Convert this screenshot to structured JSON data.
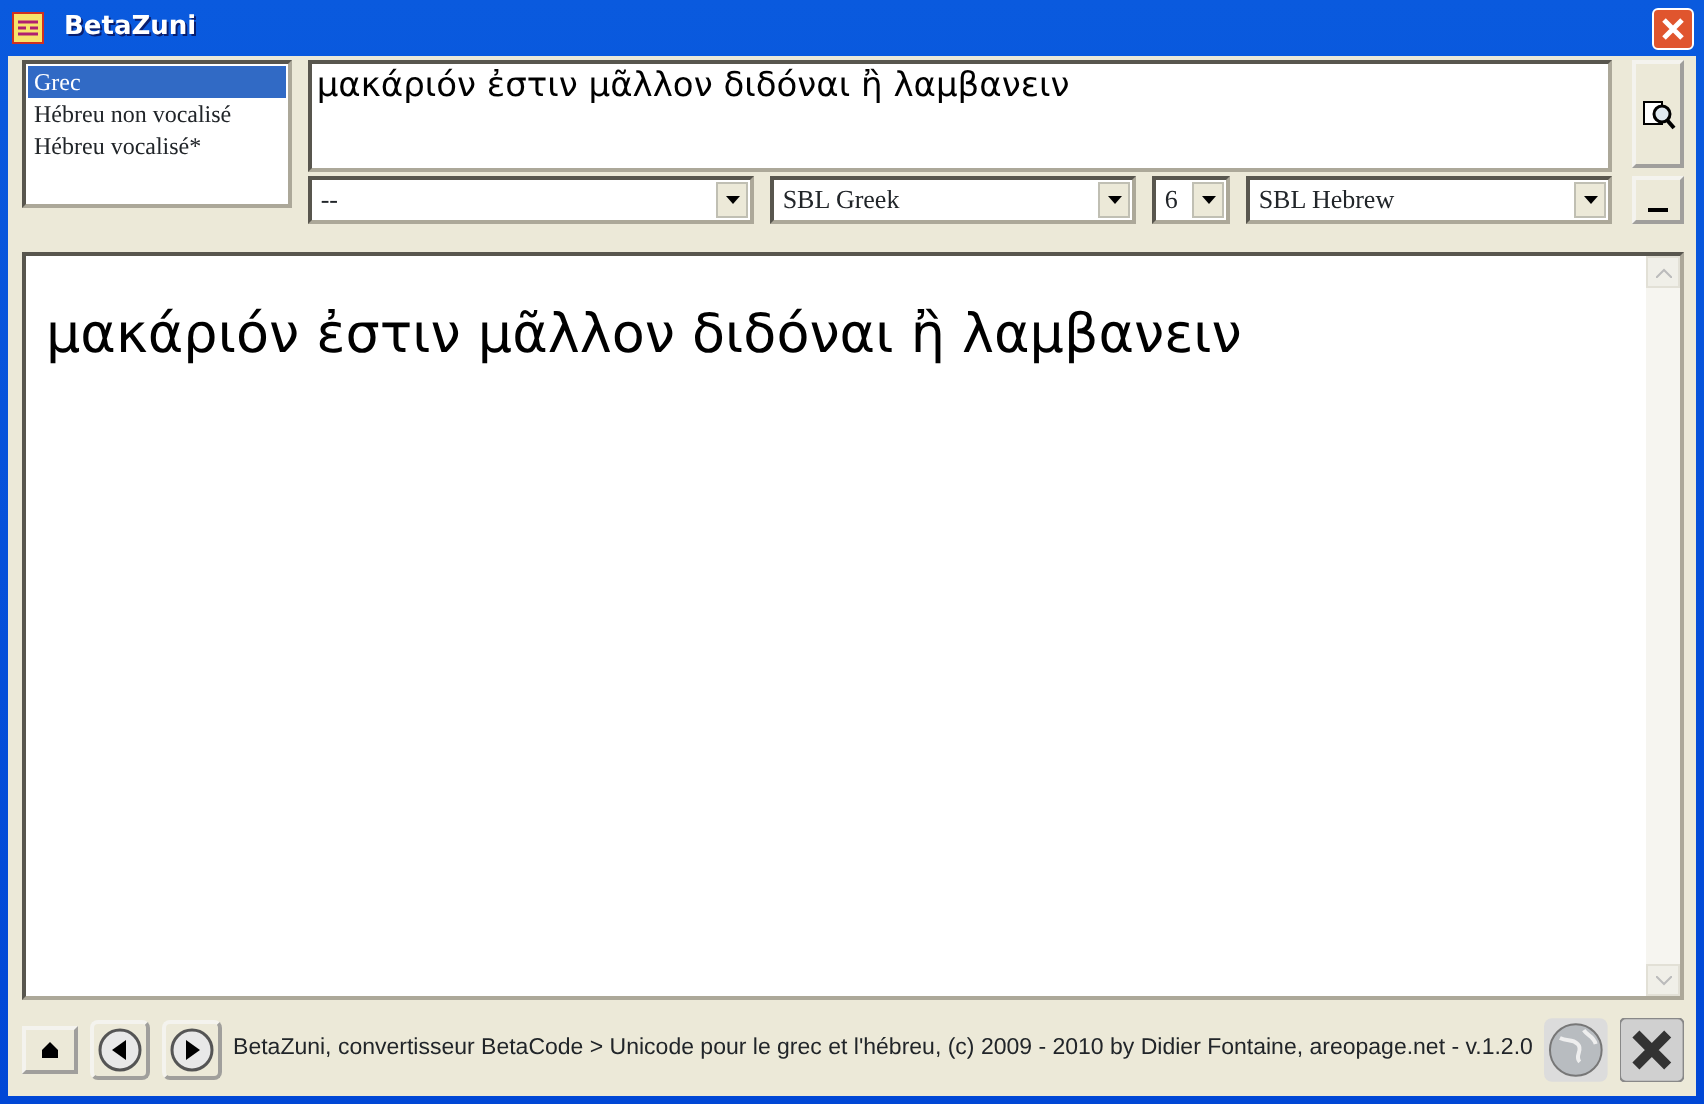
{
  "window": {
    "title": "BetaZuni"
  },
  "languages": [
    {
      "label": "Grec",
      "selected": true
    },
    {
      "label": "Hébreu non vocalisé",
      "selected": false
    },
    {
      "label": "Hébreu vocalisé*",
      "selected": false
    }
  ],
  "input": {
    "value": "μακάριόν ἐστιν μᾶλλον διδόναι ἢ λαμβανειν"
  },
  "selects": [
    {
      "value": "--"
    },
    {
      "value": "SBL Greek"
    },
    {
      "value": "6"
    },
    {
      "value": "SBL Hebrew"
    }
  ],
  "output": {
    "text": "μακάριόν ἐστιν μᾶλλον διδόναι ἢ λαμβανειν"
  },
  "footer": {
    "text": "BetaZuni, convertisseur BetaCode > Unicode pour le grec et l'hébreu, (c) 2009 - 2010 by Didier Fontaine, areopage.net - v.1.2.0"
  }
}
